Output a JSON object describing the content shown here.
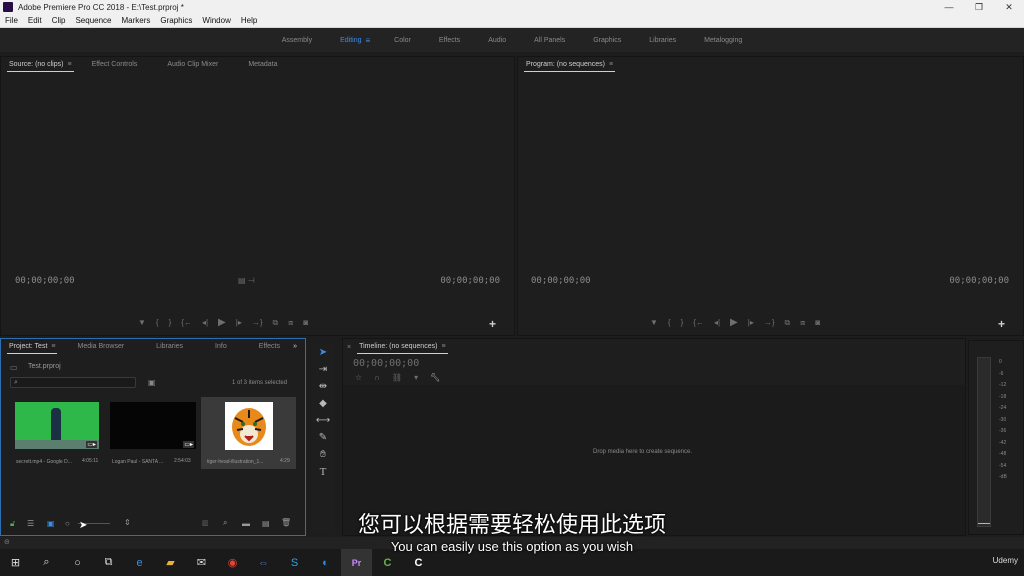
{
  "window": {
    "title": "Adobe Premiere Pro CC 2018 - E:\\Test.prproj *",
    "minimize": "—",
    "restore": "❐",
    "close": "✕"
  },
  "menu": [
    "File",
    "Edit",
    "Clip",
    "Sequence",
    "Markers",
    "Graphics",
    "Window",
    "Help"
  ],
  "workspaces": {
    "items": [
      "Assembly",
      "Editing",
      "Color",
      "Effects",
      "Audio",
      "All Panels",
      "Graphics",
      "Libraries",
      "Metalogging"
    ],
    "active": "Editing"
  },
  "source_panel": {
    "tabs": [
      "Source: (no clips)",
      "Effect Controls",
      "Audio Clip Mixer",
      "Metadata"
    ],
    "timecode_left": "00;00;00;00",
    "timecode_right": "00;00;00;00"
  },
  "program_panel": {
    "tabs": [
      "Program: (no sequences)"
    ],
    "timecode_left": "00;00;00;00",
    "timecode_right": "00;00;00;00"
  },
  "project_panel": {
    "tabs": [
      "Project: Test",
      "Media Browser",
      "Libraries",
      "Info",
      "Effects"
    ],
    "overflow": "»",
    "file_name": "Test.prproj",
    "search_placeholder": "",
    "items_selected": "1 of 3 items selected",
    "items": [
      {
        "label": "secrett.mp4 - Google D...",
        "duration": "4:05:11"
      },
      {
        "label": "Logan Paul - SANTA ...",
        "duration": "2:54:03"
      },
      {
        "label": "tiger-head-illustration_1...",
        "duration": "4:29"
      }
    ]
  },
  "timeline_panel": {
    "tab": "Timeline: (no sequences)",
    "timecode": "00;00;00;00",
    "empty_message": "Drop media here to create sequence."
  },
  "audio_meter": {
    "scale": [
      "0",
      "-6",
      "-12",
      "-18",
      "-24",
      "-30",
      "-36",
      "-42",
      "-48",
      "-54",
      "-dB"
    ]
  },
  "subtitles": {
    "chinese": "您可以根据需要轻松使用此选项",
    "english": "You can easily use this option as you wish"
  },
  "taskbar": {
    "watermark": "Udemy"
  },
  "colors": {
    "accent": "#3a8ee6",
    "panel_bg": "#1e1e1e",
    "chroma_green": "#2fb84a"
  }
}
